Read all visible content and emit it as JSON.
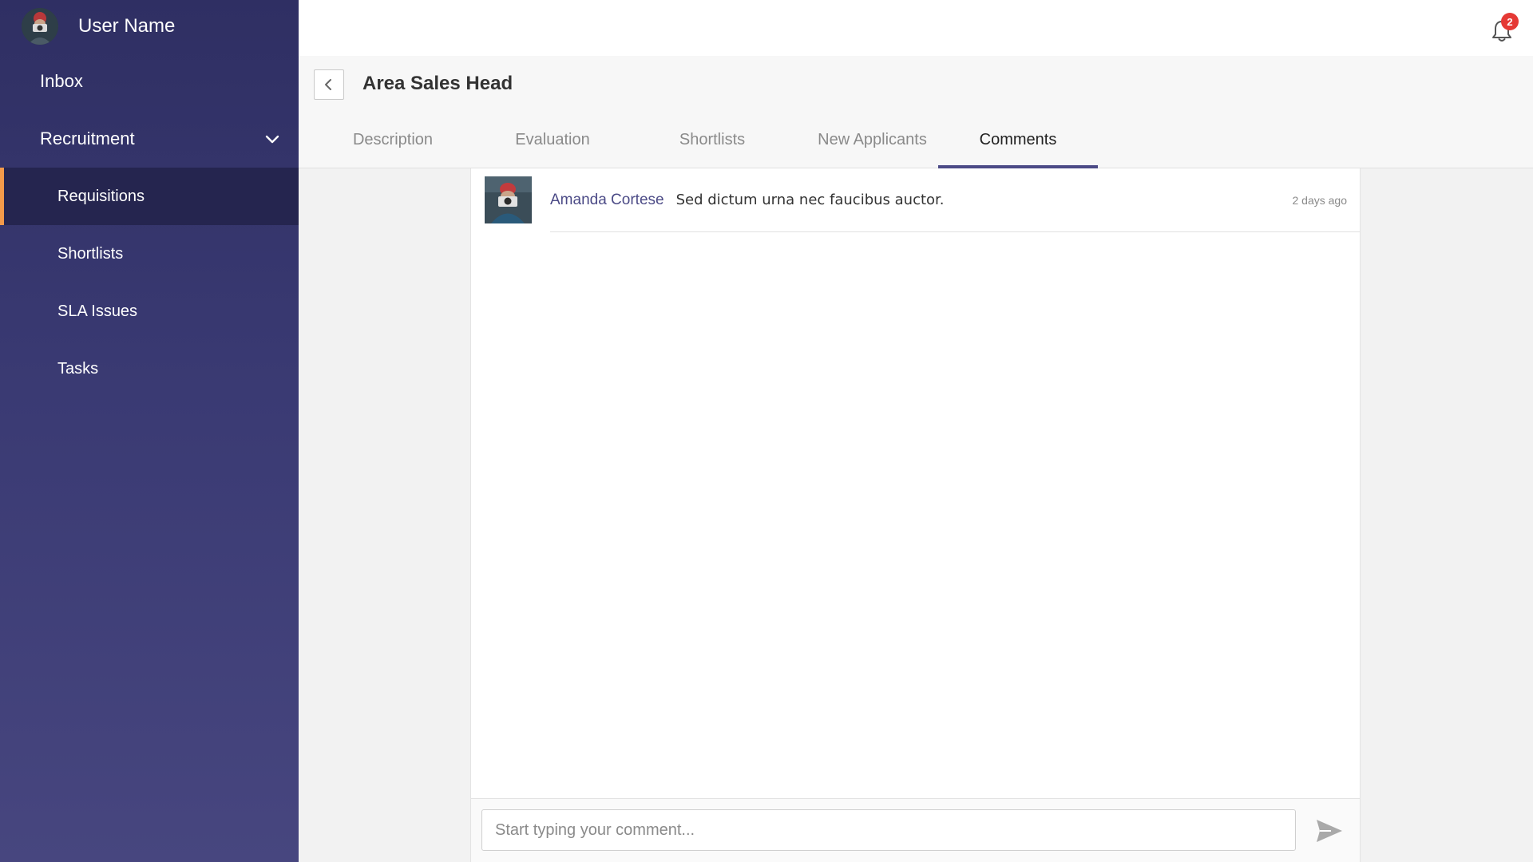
{
  "user": {
    "name": "User Name"
  },
  "sidebar": {
    "items": [
      {
        "label": "Inbox"
      },
      {
        "label": "Recruitment",
        "expanded": true,
        "children": [
          {
            "label": "Requisitions",
            "active": true
          },
          {
            "label": "Shortlists"
          },
          {
            "label": "SLA Issues"
          },
          {
            "label": "Tasks"
          }
        ]
      }
    ]
  },
  "topbar": {
    "notifications_count": "2",
    "icon": "bell-icon"
  },
  "header": {
    "title": "Area Sales Head",
    "tabs": [
      {
        "label": "Description"
      },
      {
        "label": "Evaluation"
      },
      {
        "label": "Shortlists"
      },
      {
        "label": "New Applicants"
      },
      {
        "label": "Comments",
        "active": true
      }
    ]
  },
  "comments": [
    {
      "author": "Amanda Cortese",
      "text": "Sed dictum urna nec faucibus auctor.",
      "time": "2 days ago"
    }
  ],
  "composer": {
    "placeholder": "Start typing your comment..."
  },
  "colors": {
    "accent": "#4b4a86",
    "active_indicator": "#f39a4a",
    "badge": "#e53935"
  }
}
